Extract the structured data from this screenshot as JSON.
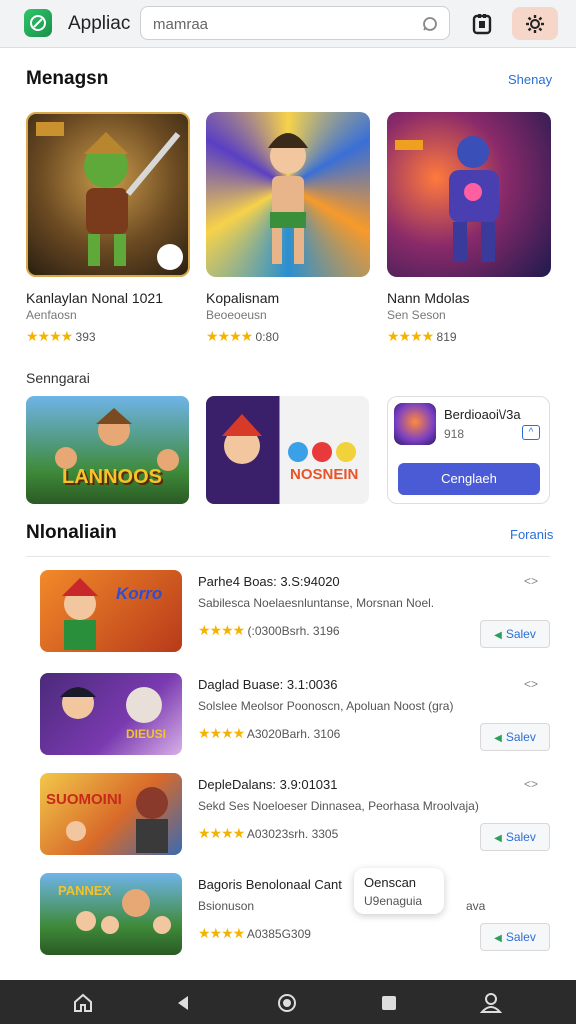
{
  "header": {
    "app_title": "Appliac",
    "search_value": "mamraa",
    "colors": {
      "logo": "#2fc66b",
      "settings_bg": "#f5d6c9"
    }
  },
  "featured": {
    "title": "Menagsn",
    "link": "Shenay",
    "items": [
      {
        "name": "Kanlaylan Nonal 1021",
        "sub": "Aenfaosn",
        "stars": "★★★★",
        "rating": "393"
      },
      {
        "name": "Kopalisnam",
        "sub": "Beoeoeusn",
        "stars": "★★★★",
        "rating": "0:80"
      },
      {
        "name": "Nann Mdolas",
        "sub": "Sen Seson",
        "stars": "★★★★",
        "rating": "819"
      }
    ]
  },
  "secondary": {
    "title": "Senngarai",
    "banner1_text": "LANNOOS",
    "banner2_text": "NOSNEIN",
    "promo": {
      "name": "Berdioaoi\\/3a",
      "sub": "918",
      "tag": "^",
      "button": "Cenglaeh"
    }
  },
  "list": {
    "title": "Nlonaliain",
    "link": "Foranis",
    "share_icon": "<> ",
    "items": [
      {
        "title": "Parhe4 Boas: 3.S:94020",
        "desc": "Sabilesca Noelaesnluntanse, Morsnan Noel.",
        "stars": "★★★★",
        "meta": "(:0300Bsrh. 3196",
        "action": "Salev",
        "thumb_text": "Korro"
      },
      {
        "title": "Daglad Buase: 3.1:0036",
        "desc": "Solslee Meolsor Poonoscn, Apoluan Noost (gra)",
        "stars": "★★★★",
        "meta": "A3020Barh. 3106",
        "action": "Salev",
        "thumb_text": "DIEUSI"
      },
      {
        "title": "DepleDalans: 3.9:01031",
        "desc": "Sekd Ses Noeloeser Dinnasea, Peorhasa Mroolvaja)",
        "stars": "★★★★",
        "meta": "A03023srh. 3305",
        "action": "Salev",
        "thumb_text": "SUOMOINI"
      },
      {
        "title": "Bagoris Benolonaal Cant",
        "desc": "Bsionuson",
        "desc_tail": "ava",
        "stars": "★★★★",
        "meta": "A0385G309",
        "action": "Salev",
        "thumb_text": "PANNEX"
      }
    ],
    "tooltip": {
      "line1": "Oenscan",
      "line2": "U9enaguia"
    }
  }
}
